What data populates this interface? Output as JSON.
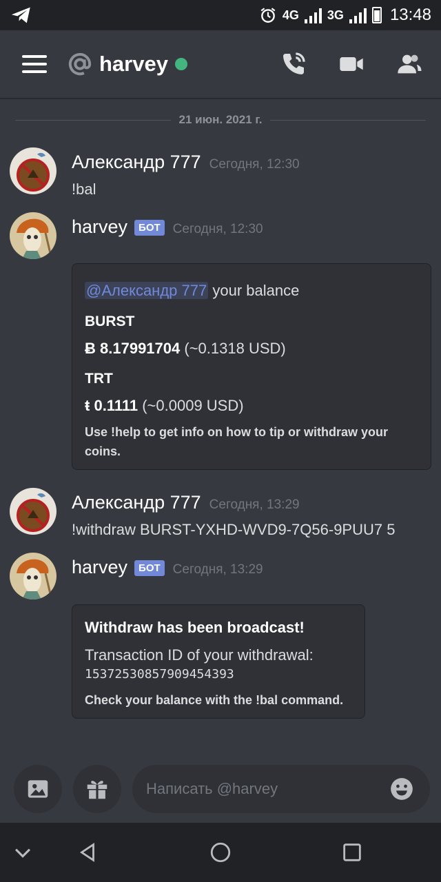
{
  "status_bar": {
    "network_1": "4G",
    "network_2": "3G",
    "time": "13:48"
  },
  "header": {
    "channel_name": "harvey",
    "status": "online",
    "icons": [
      "menu-icon",
      "at-icon",
      "call-icon",
      "video-icon",
      "members-icon"
    ]
  },
  "date_divider": "21 июн. 2021 г.",
  "messages": [
    {
      "author": "Александр 777",
      "timestamp": "Сегодня, 12:30",
      "text": "!bal"
    },
    {
      "author": "harvey",
      "bot_tag": "БОТ",
      "timestamp": "Сегодня, 12:30",
      "embed": {
        "mention": "@Александр 777",
        "description_rest": " your balance",
        "fields": [
          {
            "name": "BURST",
            "symbol": "Ƀ",
            "amount": "8.17991704",
            "usd": " (~0.1318 USD)"
          },
          {
            "name": "TRT",
            "symbol": "ŧ",
            "amount": "0.1111",
            "usd": " (~0.0009 USD)"
          }
        ],
        "footer": "Use !help to get info on how to tip or withdraw your coins."
      }
    },
    {
      "author": "Александр 777",
      "timestamp": "Сегодня, 13:29",
      "text": "!withdraw  BURST-YXHD-WVD9-7Q56-9PUU7 5"
    },
    {
      "author": "harvey",
      "bot_tag": "БОТ",
      "timestamp": "Сегодня, 13:29",
      "embed": {
        "title": "Withdraw has been broadcast!",
        "line": "Transaction ID of your withdrawal:",
        "tx_id": "15372530857909454393",
        "footer": "Check your balance with the !bal command."
      }
    }
  ],
  "composer": {
    "placeholder": "Написать @harvey",
    "value": ""
  },
  "colors": {
    "background": "#36393f",
    "embed": "#2f3136",
    "accent": "#7289da",
    "online": "#43b581"
  }
}
